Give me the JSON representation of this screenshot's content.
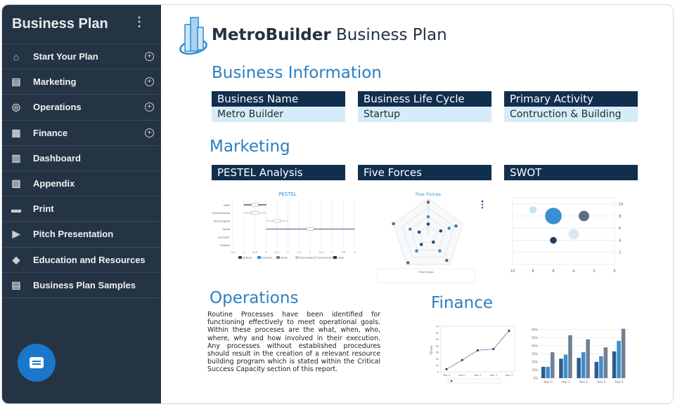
{
  "sidebar": {
    "title": "Business Plan",
    "items": [
      {
        "label": "Start Your Plan",
        "icon": "home-icon",
        "expandable": true
      },
      {
        "label": "Marketing",
        "icon": "documents-icon",
        "expandable": true
      },
      {
        "label": "Operations",
        "icon": "radar-icon",
        "expandable": true
      },
      {
        "label": "Finance",
        "icon": "calendar-icon",
        "expandable": true
      },
      {
        "label": "Dashboard",
        "icon": "bar-chart-icon",
        "expandable": false
      },
      {
        "label": "Appendix",
        "icon": "images-icon",
        "expandable": false
      },
      {
        "label": "Print",
        "icon": "printer-icon",
        "expandable": false
      },
      {
        "label": "Pitch Presentation",
        "icon": "play-icon",
        "expandable": false
      },
      {
        "label": "Education and Resources",
        "icon": "graduation-cap-icon",
        "expandable": false
      },
      {
        "label": "Business Plan Samples",
        "icon": "clipboard-icon",
        "expandable": false
      }
    ]
  },
  "header": {
    "brand": "MetroBuilder",
    "title_rest": "Business Plan"
  },
  "business_info": {
    "heading": "Business Information",
    "fields": [
      {
        "label": "Business Name",
        "value": "Metro Builder"
      },
      {
        "label": "Business Life Cycle",
        "value": "Startup"
      },
      {
        "label": "Primary Activity",
        "value": "Contruction & Building"
      }
    ]
  },
  "marketing": {
    "heading": "Marketing",
    "cards": [
      "PESTEL Analysis",
      "Five Forces",
      "SWOT"
    ]
  },
  "operations": {
    "heading": "Operations",
    "text": "Routine Processes have been identified for functioning effectively to meet operational goals. Within these proceses are the what, when, who, where, why and how involved in their execution. Any processes without established procedures should result in the creation of a relevant resource building program which is stated within the Critical Success Capacity section of this report."
  },
  "finance": {
    "heading": "Finance"
  },
  "colors": {
    "dark": "#1f4e79",
    "mid": "#3b8fd0",
    "slate": "#6f7f95",
    "light": "#c9e2f3",
    "header": "#102f4d",
    "accent": "#2a7fc1"
  },
  "chart_data": [
    {
      "type": "bar",
      "title": "PESTEL",
      "orientation": "horizontal",
      "categories": [
        "Legal",
        "Environmental",
        "Technological",
        "Social",
        "Economic",
        "Political"
      ],
      "ranges": [
        [
          -1,
          0
        ],
        [
          -1,
          0
        ],
        [
          0,
          1
        ],
        [
          0,
          4
        ],
        [
          0,
          0
        ],
        [
          0,
          0
        ]
      ],
      "xlim": [
        -1.5,
        4
      ],
      "xticks": [
        "-1.5",
        "-1",
        "-0.5",
        "0",
        "0.5",
        "1",
        "1.5",
        "2",
        "2.5",
        "3",
        "3.5",
        "4"
      ],
      "legend": [
        "Political",
        "Economic",
        "Social",
        "Technological",
        "Environmental",
        "Legal"
      ]
    },
    {
      "type": "radar",
      "title": "Five Forces",
      "axes": 5,
      "rmax": 5,
      "series": [
        {
          "values": [
            1.5,
            1.8,
            1.2,
            1.6,
            1.3
          ]
        },
        {
          "values": [
            2.5,
            3,
            2.7,
            2.7,
            2.6
          ]
        },
        {
          "values": [
            4.5,
            4,
            4.3,
            4.7,
            5
          ]
        }
      ],
      "legend_title": "Five Forces"
    },
    {
      "type": "scatter",
      "subtype": "bubble",
      "xlim": [
        10,
        0
      ],
      "ylim": [
        0,
        11
      ],
      "xticks": [
        "10",
        "8",
        "6",
        "4",
        "2",
        "0"
      ],
      "yticks": [
        "2",
        "4",
        "6",
        "8",
        "10"
      ],
      "points": [
        {
          "x": 8,
          "y": 9,
          "size": 1,
          "color": "#c9e2f3"
        },
        {
          "x": 6,
          "y": 8,
          "size": 4,
          "color": "#3b8fd0"
        },
        {
          "x": 3,
          "y": 8,
          "size": 2,
          "color": "#5d6d83"
        },
        {
          "x": 4,
          "y": 5,
          "size": 2,
          "color": "#d6e9f5"
        },
        {
          "x": 6,
          "y": 4,
          "size": 0.8,
          "color": "#1f3f5e"
        }
      ]
    },
    {
      "type": "line",
      "categories": [
        "Year 0",
        "Year 1",
        "Year 2",
        "Year 3",
        "Year 4"
      ],
      "values": [
        4,
        18,
        33,
        35,
        63
      ],
      "ylabel": "Times",
      "ylim": [
        0,
        70
      ],
      "yticks": [
        "0",
        "10",
        "20",
        "30",
        "40",
        "50",
        "60",
        "70"
      ]
    },
    {
      "type": "bar",
      "categories": [
        "Year 0",
        "Year 1",
        "Year 2",
        "Year 3",
        "Year 4"
      ],
      "ylim": [
        0,
        65
      ],
      "yticks": [
        "0%",
        "10%",
        "20%",
        "30%",
        "40%",
        "50%",
        "60%"
      ],
      "series": [
        {
          "values": [
            14,
            24,
            25,
            20,
            33
          ]
        },
        {
          "values": [
            14,
            29,
            32,
            27,
            46
          ]
        },
        {
          "values": [
            32,
            53,
            48,
            38,
            61
          ]
        }
      ]
    }
  ]
}
